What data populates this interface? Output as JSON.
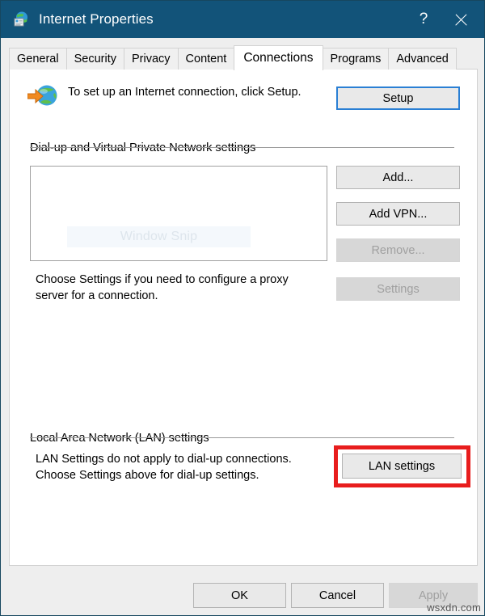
{
  "window": {
    "title": "Internet Properties",
    "icon": "internet-properties-icon",
    "help_label": "?",
    "close_label": "✕",
    "accent_titlebar": "#125379",
    "border_color": "#17475f"
  },
  "tabs": [
    {
      "label": "General",
      "active": false
    },
    {
      "label": "Security",
      "active": false
    },
    {
      "label": "Privacy",
      "active": false
    },
    {
      "label": "Content",
      "active": false
    },
    {
      "label": "Connections",
      "active": true
    },
    {
      "label": "Programs",
      "active": false
    },
    {
      "label": "Advanced",
      "active": false
    }
  ],
  "connections": {
    "setup": {
      "description": "To set up an Internet connection, click Setup.",
      "button_label": "Setup",
      "icon": "globe-with-arrow-icon",
      "focused": true
    },
    "dialup_group": {
      "label": "Dial-up and Virtual Private Network settings",
      "listbox_watermark": "Window Snip",
      "buttons": [
        {
          "label": "Add...",
          "enabled": true
        },
        {
          "label": "Add VPN...",
          "enabled": true
        },
        {
          "label": "Remove...",
          "enabled": false
        },
        {
          "label": "Settings",
          "enabled": false
        }
      ],
      "proxy_description": "Choose Settings if you need to configure a proxy server for a connection."
    },
    "lan_group": {
      "label": "Local Area Network (LAN) settings",
      "description": "LAN Settings do not apply to dial-up connections. Choose Settings above for dial-up settings.",
      "button_label": "LAN settings",
      "highlight_color": "#e81d1d"
    }
  },
  "footer": {
    "ok_label": "OK",
    "cancel_label": "Cancel",
    "apply_label": "Apply",
    "apply_enabled": false
  },
  "watermark": {
    "site": "wsxdn.com"
  }
}
